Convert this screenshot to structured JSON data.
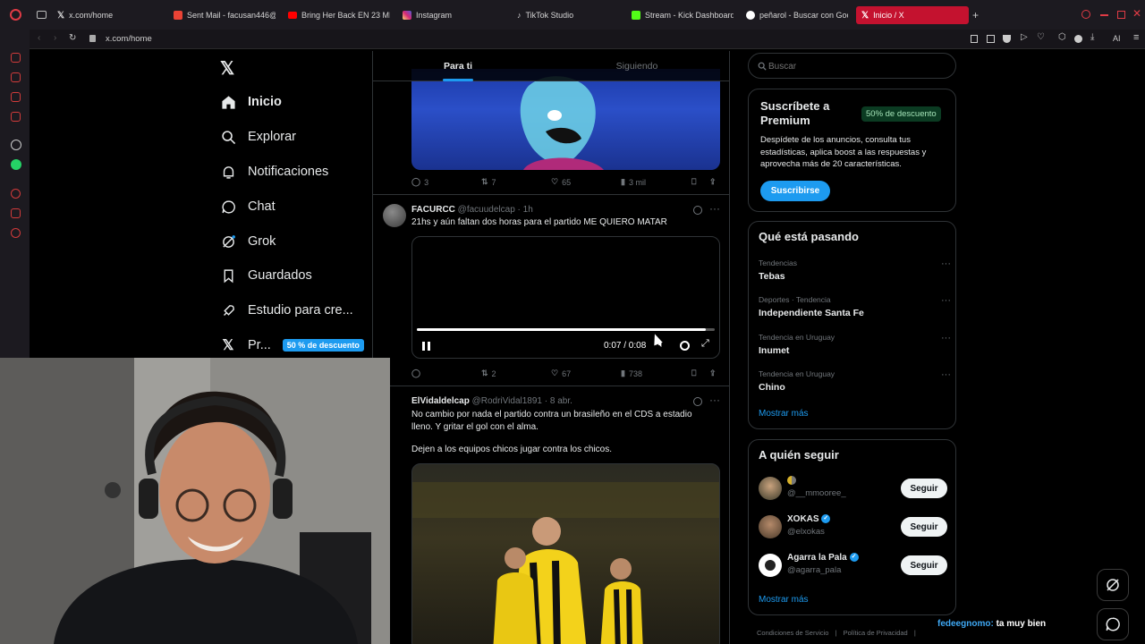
{
  "browser": {
    "tabs": [
      {
        "label": "x.com/home",
        "color": "#e7e9ea"
      },
      {
        "label": "Sent Mail - facusan446@",
        "color": "#ea4335"
      },
      {
        "label": "Bring Her Back EN 23 MIN",
        "color": "#ff0000"
      },
      {
        "label": "Instagram",
        "color": "#d62976"
      },
      {
        "label": "TikTok Studio",
        "color": "#ffffff"
      },
      {
        "label": "Stream - Kick Dashboard",
        "color": "#53fc18"
      },
      {
        "label": "peñarol - Buscar con Goo",
        "color": "#4285f4"
      },
      {
        "label": "Inicio / X",
        "color": "#ffffff"
      }
    ],
    "address": "x.com/home",
    "ai_label": "AI",
    "accent": "#c4122f"
  },
  "nav": {
    "items": [
      {
        "label": "Inicio",
        "icon": "home-icon"
      },
      {
        "label": "Explorar",
        "icon": "search-icon"
      },
      {
        "label": "Notificaciones",
        "icon": "bell-icon"
      },
      {
        "label": "Chat",
        "icon": "chat-icon"
      },
      {
        "label": "Grok",
        "icon": "grok-icon"
      },
      {
        "label": "Guardados",
        "icon": "bookmark-icon"
      },
      {
        "label": "Estudio para cre...",
        "icon": "rocket-icon"
      },
      {
        "label": "Pr...",
        "icon": "x-logo-icon"
      }
    ],
    "premium_badge": "50 % de descuento"
  },
  "feed": {
    "tabs": [
      "Para ti",
      "Siguiendo"
    ],
    "post1_stats": {
      "replies": "3",
      "reposts": "7",
      "likes": "65",
      "views": "3 mil"
    },
    "post2": {
      "name": "FACURCC",
      "handle": "@facuudelcap",
      "time": "· 1h",
      "text": "21hs y aún faltan dos horas para el partido ME QUIERO MATAR",
      "video_time": "0:07 / 0:08",
      "stats": {
        "replies": "",
        "reposts": "2",
        "likes": "67",
        "views": "738"
      },
      "progress": 0.97
    },
    "post3": {
      "name": "ElVidaldelcap",
      "handle": "@RodriVidal1891",
      "time": "· 8 abr.",
      "text1": "No cambio por nada el partido contra un brasileño en el CDS a estadio lleno. Y gritar el gol con el alma.",
      "text2": "Dejen a los equipos chicos jugar contra los chicos."
    }
  },
  "right": {
    "search_placeholder": "Buscar",
    "premium": {
      "title": "Suscríbete a Premium",
      "badge": "50% de descuento",
      "desc": "Despídete de los anuncios, consulta tus estadísticas, aplica boost a las respuestas y aprovecha más de 20 características.",
      "button": "Suscribirse"
    },
    "trends_title": "Qué está pasando",
    "trends": [
      {
        "meta": "Tendencias",
        "name": "Tebas"
      },
      {
        "meta": "Deportes · Tendencia",
        "name": "Independiente Santa Fe"
      },
      {
        "meta": "Tendencia en Uruguay",
        "name": "Inumet"
      },
      {
        "meta": "Tendencia en Uruguay",
        "name": "Chino"
      }
    ],
    "show_more": "Mostrar más",
    "follow_title": "A quién seguir",
    "follows": [
      {
        "name": "",
        "handle": "@__mmooree_",
        "verified": false
      },
      {
        "name": "XOKAS",
        "handle": "@elxokas",
        "verified": true
      },
      {
        "name": "Agarra la Pala",
        "handle": "@agarra_pala",
        "verified": true
      }
    ],
    "follow_button": "Seguir",
    "show_more2": "Mostrar más",
    "footer": [
      "Condiciones de Servicio",
      "|",
      "Política de Privacidad",
      "|"
    ]
  },
  "chat_overlay": {
    "user": "fedeegnomo:",
    "message": "ta muy bien"
  }
}
